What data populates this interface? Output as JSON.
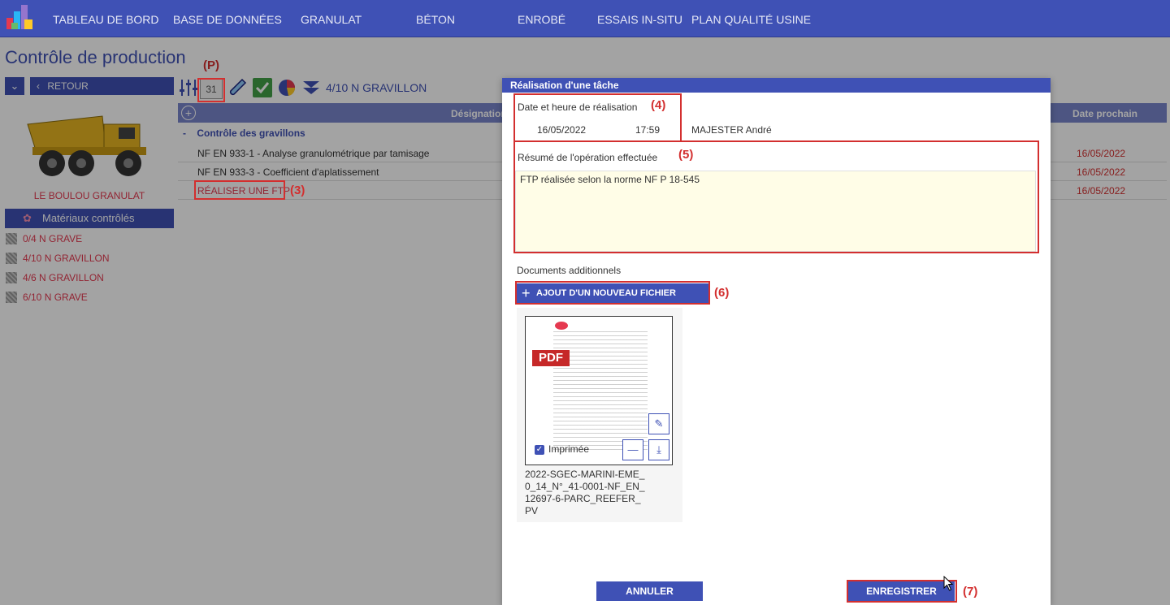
{
  "nav": {
    "items": [
      "TABLEAU DE BORD",
      "BASE DE DONNÉES",
      "GRANULAT",
      "BÉTON",
      "ENROBÉ",
      "ESSAIS IN-SITU",
      "PLAN QUALITÉ USINE"
    ]
  },
  "page": {
    "title": "Contrôle de production"
  },
  "tags": {
    "p": "(P)",
    "t3": "(3)",
    "t4": "(4)",
    "t5": "(5)",
    "t6": "(6)",
    "t7": "(7)"
  },
  "left": {
    "back_label": "RETOUR",
    "site_name": "LE BOULOU GRANULAT",
    "materials_header": "Matériaux contrôlés",
    "materials": [
      "0/4 N GRAVE",
      "4/10 N GRAVILLON",
      "4/6 N GRAVILLON",
      "6/10 N GRAVE"
    ]
  },
  "toolbar": {
    "calendar_day": "31",
    "material_title": "4/10 N GRAVILLON"
  },
  "grid": {
    "col_designation": "Désignation",
    "col_next_date": "Date prochain",
    "group": "Contrôle des gravillons",
    "rows": [
      {
        "label": "NF EN 933-1 - Analyse granulométrique par tamisage",
        "date": "16/05/2022"
      },
      {
        "label": "NF EN 933-3 - Coefficient d'aplatissement",
        "date": "16/05/2022"
      },
      {
        "label": "RÉALISER UNE FTP",
        "date": "16/05/2022"
      }
    ],
    "collapse_symbol": "-"
  },
  "dialog": {
    "title": "Réalisation d'une tâche",
    "date_label": "Date et heure de réalisation",
    "date_value": "16/05/2022",
    "time_value": "17:59",
    "operator": "MAJESTER André",
    "summary_label": "Résumé de l'opération effectuée",
    "summary_value": "FTP réalisée selon la norme NF P 18-545",
    "docs_label": "Documents additionnels",
    "add_file_label": "AJOUT D'UN NOUVEAU FICHIER",
    "file": {
      "pdf_badge": "PDF",
      "printed_label": "Imprimée",
      "name": "2022-SGEC-MARINI-EME_0_14_N°_41-0001-NF_EN_12697-6-PARC_REEFER_PV"
    },
    "cancel_label": "ANNULER",
    "save_label": "ENREGISTRER"
  },
  "colors": {
    "primary": "#3f51b5",
    "annotation": "#d32f2f",
    "link": "#e53950",
    "textarea_bg": "#fffde7"
  }
}
